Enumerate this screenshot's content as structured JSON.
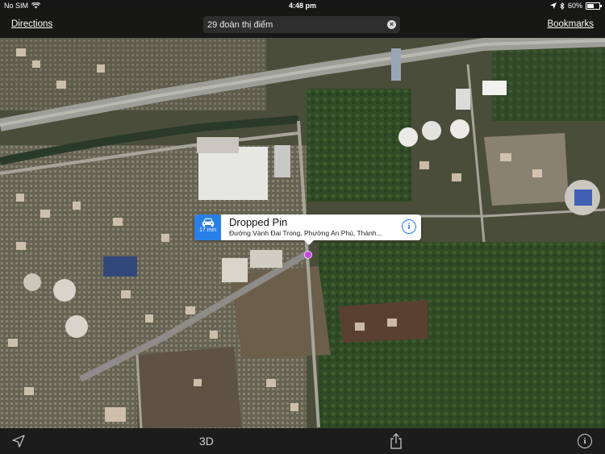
{
  "status_bar": {
    "carrier": "No SIM",
    "time": "4:48 pm",
    "battery": "60%",
    "battery_level": 0.6
  },
  "toolbar": {
    "directions_label": "Directions",
    "search_value": "29 đoàn thị điểm",
    "bookmarks_label": "Bookmarks"
  },
  "callout": {
    "eta": "17 min",
    "title": "Dropped Pin",
    "address": "Đường Vành Đai Trong, Phường An Phú, Thành..."
  },
  "bottom_bar": {
    "three_d_label": "3D"
  },
  "icons": {
    "wifi": "wifi-icon",
    "location_arrow": "location-arrow-icon",
    "bluetooth": "bluetooth-icon",
    "car": "car-icon",
    "share": "share-icon",
    "info": "info-icon"
  },
  "colors": {
    "accent": "#2a7ee8",
    "pin": "#c04ad8"
  }
}
